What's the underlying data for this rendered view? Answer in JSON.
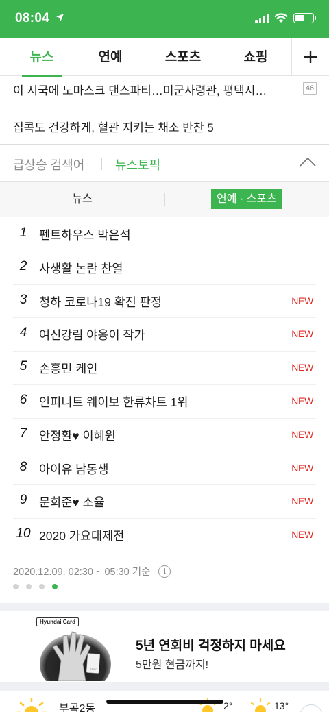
{
  "status_bar": {
    "time": "08:04"
  },
  "tabs": [
    {
      "label": "뉴스",
      "active": true
    },
    {
      "label": "연예"
    },
    {
      "label": "스포츠"
    },
    {
      "label": "쇼핑"
    }
  ],
  "headlines": [
    {
      "text": "이 시국에 노마스크 댄스파티…미군사령관, 평택시…",
      "badge": "46"
    },
    {
      "text": "집콕도 건강하게, 혈관 지키는 채소 반찬 5"
    }
  ],
  "trending": {
    "tab_search": "급상승 검색어",
    "tab_topic": "뉴스토픽",
    "subtab_news": "뉴스",
    "subtab_ent": "연예 · 스포츠",
    "items": [
      {
        "rank": "1",
        "text": "펜트하우스 박은석",
        "tag": ""
      },
      {
        "rank": "2",
        "text": "사생활 논란 찬열",
        "tag": ""
      },
      {
        "rank": "3",
        "text": "청하 코로나19 확진 판정",
        "tag": "NEW"
      },
      {
        "rank": "4",
        "text": "여신강림 야옹이 작가",
        "tag": "NEW"
      },
      {
        "rank": "5",
        "text": "손흥민 케인",
        "tag": "NEW"
      },
      {
        "rank": "6",
        "text": "인피니트 웨이보 한류차트 1위",
        "tag": "NEW"
      },
      {
        "rank": "7",
        "text": "안정환♥ 이혜원",
        "tag": "NEW"
      },
      {
        "rank": "8",
        "text": "아이유 남동생",
        "tag": "NEW"
      },
      {
        "rank": "9",
        "text": "문희준♥ 소율",
        "tag": "NEW"
      },
      {
        "rank": "10",
        "text": "2020 가요대제전",
        "tag": "NEW"
      }
    ],
    "timestamp": "2020.12.09. 02:30 ~ 05:30 기준",
    "page_dots": {
      "count": 4,
      "active_index": 3
    }
  },
  "ad": {
    "brand": "Hyundai Card",
    "title": "5년 연회비 걱정하지 마세요",
    "subtitle": "5만원 현금까지!",
    "card_text": "ZERO"
  },
  "weather": {
    "location": "부곡2동",
    "temp_1": "2°",
    "temp_2": "13°"
  },
  "colors": {
    "accent": "#3cb550",
    "new_tag": "#e0271f"
  }
}
